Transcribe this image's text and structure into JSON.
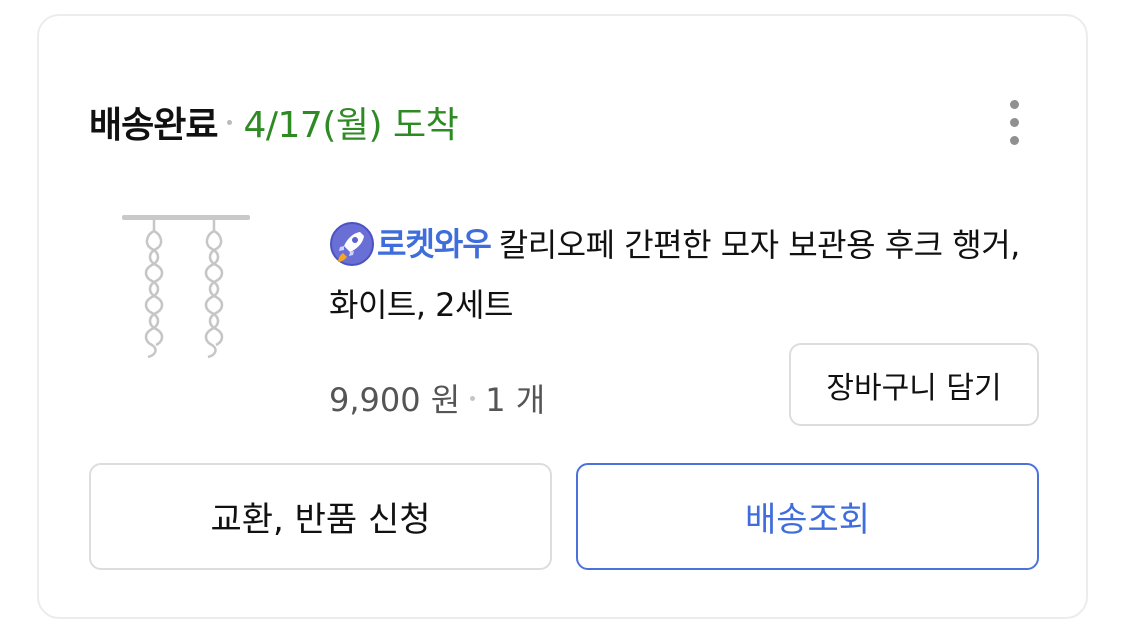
{
  "delivery": {
    "status": "배송완료",
    "arrival": "4/17(월) 도착"
  },
  "icons": {
    "more": "more-vertical-icon",
    "rocket": "rocket-wow-icon"
  },
  "product": {
    "badge": "로켓와우",
    "name": "칼리오페 간편한 모자 보관용 후크 행거, 화이트, 2세트",
    "price": "9,900 원",
    "quantity": "1 개",
    "image_alt": "product-thumbnail"
  },
  "actions": {
    "cart": "장바구니 담기",
    "return": "교환, 반품 신청",
    "track": "배송조회"
  },
  "colors": {
    "arrival": "#2e8b24",
    "brand_blue": "#3f6ddb"
  }
}
